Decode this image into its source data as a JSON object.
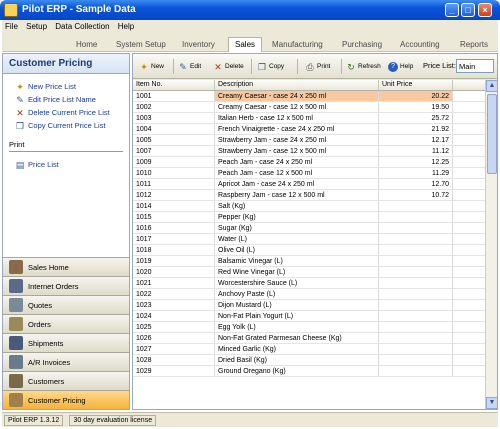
{
  "window": {
    "title": "Pilot ERP - Sample Data",
    "min": "_",
    "max": "□",
    "close": "×"
  },
  "menu": [
    "File",
    "Setup",
    "Data Collection",
    "Help"
  ],
  "modules": [
    "Home",
    "System Setup",
    "Inventory",
    "Sales",
    "Manufacturing",
    "Purchasing",
    "Accounting",
    "Reports"
  ],
  "active_module": "Sales",
  "left": {
    "title": "Customer Pricing",
    "actions": [
      {
        "label": "New Price List",
        "icon": "new-icon"
      },
      {
        "label": "Edit Price List Name",
        "icon": "edit-icon"
      },
      {
        "label": "Delete Current Price List",
        "icon": "delete-icon"
      },
      {
        "label": "Copy Current Price List",
        "icon": "copy-icon"
      }
    ],
    "print_header": "Print",
    "print_items": [
      {
        "label": "Price List",
        "icon": "document-icon"
      }
    ],
    "nav": [
      {
        "label": "Sales Home",
        "icon": "home-icon",
        "color": "#8a6a4a"
      },
      {
        "label": "Internet Orders",
        "icon": "cart-icon",
        "color": "#5a6a8a"
      },
      {
        "label": "Quotes",
        "icon": "quote-icon",
        "color": "#7a8a9a"
      },
      {
        "label": "Orders",
        "icon": "orders-icon",
        "color": "#9a8a5a"
      },
      {
        "label": "Shipments",
        "icon": "truck-icon",
        "color": "#4a5a7a"
      },
      {
        "label": "A/R Invoices",
        "icon": "invoice-icon",
        "color": "#6a7a8a"
      },
      {
        "label": "Customers",
        "icon": "customers-icon",
        "color": "#7a6a4a"
      },
      {
        "label": "Customer Pricing",
        "icon": "pricing-icon",
        "color": "#a0804a"
      }
    ]
  },
  "toolbar": {
    "buttons": [
      {
        "label": "New",
        "icon": "new-icon"
      },
      {
        "label": "Edit",
        "icon": "edit-icon"
      },
      {
        "label": "Delete",
        "icon": "delete-icon"
      },
      {
        "label": "Copy",
        "icon": "copy-icon"
      },
      {
        "label": "Print",
        "icon": "print-icon"
      },
      {
        "label": "Refresh",
        "icon": "refresh-icon"
      },
      {
        "label": "Help",
        "icon": "help-icon"
      }
    ],
    "price_list_label": "Price List:",
    "price_list_value": "Main"
  },
  "table": {
    "columns": [
      "Item No.",
      "Description",
      "Unit Price",
      ""
    ],
    "rows": [
      [
        "1001",
        "Creamy Caesar - case 24 x 250 ml",
        "20.22"
      ],
      [
        "1002",
        "Creamy Caesar - case 12 x 500 ml",
        "19.50"
      ],
      [
        "1003",
        "Italian Herb - case 12 x 500 ml",
        "25.72"
      ],
      [
        "1004",
        "French Vinaigrette - case 24 x 250 ml",
        "21.92"
      ],
      [
        "1005",
        "Strawberry Jam - case 24 x 250 ml",
        "12.17"
      ],
      [
        "1007",
        "Strawberry Jam - case 12 x 500 ml",
        "11.12"
      ],
      [
        "1009",
        "Peach Jam - case 24 x 250 ml",
        "12.25"
      ],
      [
        "1010",
        "Peach Jam - case 12 x 500 ml",
        "11.29"
      ],
      [
        "1011",
        "Apricot Jam - case 24 x 250 ml",
        "12.70"
      ],
      [
        "1012",
        "Raspberry Jam - case 12 x 500 ml",
        "10.72"
      ],
      [
        "1014",
        "Salt (Kg)",
        ""
      ],
      [
        "1015",
        "Pepper (Kg)",
        ""
      ],
      [
        "1016",
        "Sugar (Kg)",
        ""
      ],
      [
        "1017",
        "Water (L)",
        ""
      ],
      [
        "1018",
        "Olive Oil (L)",
        ""
      ],
      [
        "1019",
        "Balsamic Vinegar (L)",
        ""
      ],
      [
        "1020",
        "Red Wine Vinegar (L)",
        ""
      ],
      [
        "1021",
        "Worcestershire Sauce (L)",
        ""
      ],
      [
        "1022",
        "Anchovy Paste (L)",
        ""
      ],
      [
        "1023",
        "Dijon Mustard (L)",
        ""
      ],
      [
        "1024",
        "Non-Fat Plain Yogurt (L)",
        ""
      ],
      [
        "1025",
        "Egg Yolk (L)",
        ""
      ],
      [
        "1026",
        "Non-Fat Grated Parmesan Cheese (Kg)",
        ""
      ],
      [
        "1027",
        "Minced Garlic (Kg)",
        ""
      ],
      [
        "1028",
        "Dried Basil (Kg)",
        ""
      ],
      [
        "1029",
        "Ground Oregano (Kg)",
        ""
      ]
    ],
    "selected_row": 0
  },
  "status": [
    "Pilot ERP 1.3.12",
    "30 day evaluation license"
  ]
}
